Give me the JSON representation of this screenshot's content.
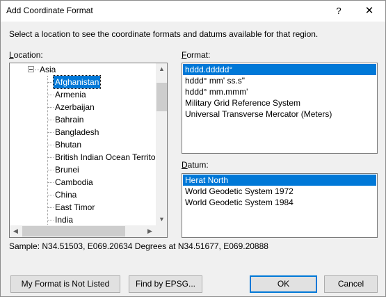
{
  "window": {
    "title": "Add Coordinate Format",
    "help": "?",
    "close": "✕"
  },
  "instruction": "Select a location to see the coordinate formats and datums available for that region.",
  "location": {
    "label_prefix": "L",
    "label_rest": "ocation:",
    "parent": "Asia",
    "items": [
      "Afghanistan",
      "Armenia",
      "Azerbaijan",
      "Bahrain",
      "Bangladesh",
      "Bhutan",
      "British Indian Ocean Territory",
      "Brunei",
      "Cambodia",
      "China",
      "East Timor",
      "India"
    ],
    "selected_index": 0
  },
  "format": {
    "label_prefix": "F",
    "label_rest": "ormat:",
    "items": [
      "hddd.ddddd°",
      "hddd° mm' ss.s\"",
      "hddd° mm.mmm'",
      "Military Grid Reference System",
      "Universal Transverse Mercator (Meters)"
    ],
    "selected_index": 0
  },
  "datum": {
    "label_prefix": "D",
    "label_rest": "atum:",
    "items": [
      "Herat North",
      "World Geodetic System 1972",
      "World Geodetic System 1984"
    ],
    "selected_index": 0
  },
  "sample": "Sample: N34.51503, E069.20634 Degrees at N34.51677, E069.20888",
  "buttons": {
    "not_listed": "My Format is Not Listed",
    "find_epsg": "Find by EPSG...",
    "ok": "OK",
    "cancel": "Cancel"
  },
  "colors": {
    "selection": "#0078d7",
    "dialog_bg": "#f0f0f0"
  }
}
